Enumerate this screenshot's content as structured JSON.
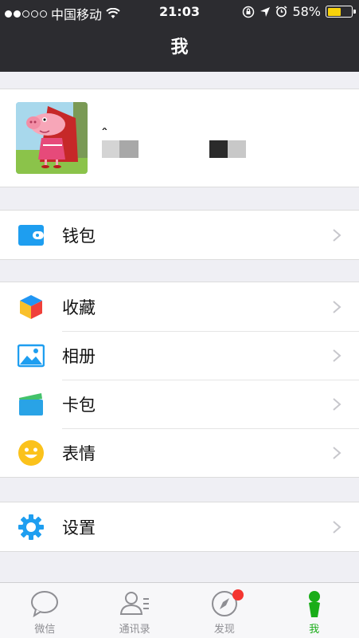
{
  "status_bar": {
    "carrier": "中国移动",
    "time": "21:03",
    "battery_percent": "58%",
    "battery_level": 0.58,
    "icons": [
      "signal-dots-icon",
      "wifi-icon",
      "orientation-lock-icon",
      "location-arrow-icon",
      "alarm-clock-icon",
      "battery-icon"
    ]
  },
  "nav": {
    "title": "我"
  },
  "profile": {
    "nickname": "ꞈ",
    "avatar_icon": "peppa-pig-avatar-icon",
    "chevron_icon": "chevron-right-icon"
  },
  "menu": {
    "wallet": {
      "label": "钱包",
      "icon": "wallet-icon"
    },
    "favorites": {
      "label": "收藏",
      "icon": "cube-icon"
    },
    "album": {
      "label": "相册",
      "icon": "photo-icon"
    },
    "card": {
      "label": "卡包",
      "icon": "card-icon"
    },
    "sticker": {
      "label": "表情",
      "icon": "smiley-icon"
    },
    "settings": {
      "label": "设置",
      "icon": "gear-icon"
    }
  },
  "tab_bar": {
    "tabs": [
      {
        "label": "微信",
        "icon": "chat-bubble-icon",
        "active": false
      },
      {
        "label": "通讯录",
        "icon": "contacts-icon",
        "active": false
      },
      {
        "label": "发现",
        "icon": "compass-icon",
        "active": false,
        "badge": true
      },
      {
        "label": "我",
        "icon": "person-icon",
        "active": true
      }
    ]
  },
  "colors": {
    "header_bg": "#2c2c30",
    "active_green": "#1aad19",
    "badge_red": "#f43530",
    "page_bg": "#efeff4"
  }
}
